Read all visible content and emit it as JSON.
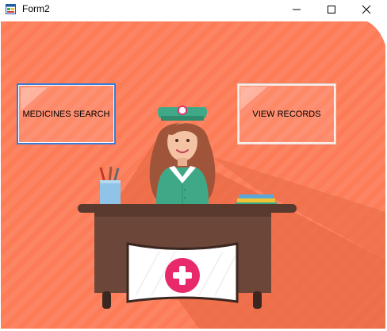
{
  "window": {
    "title": "Form2",
    "icons": {
      "app": "winforms-form-icon",
      "minimize": "minimize-icon",
      "maximize": "maximize-icon",
      "close": "close-icon"
    }
  },
  "buttons": {
    "medicines_search": "MEDICINES SEARCH",
    "view_records": "VIEW RECORDS"
  },
  "illustration": {
    "name": "nurse-at-desk-illustration",
    "colors": {
      "background": "#fd7c58",
      "shadow": "#e86a46",
      "nurse_uniform": "#3fa987",
      "desk": "#6b4639",
      "cross_badge": "#e8296b"
    }
  }
}
